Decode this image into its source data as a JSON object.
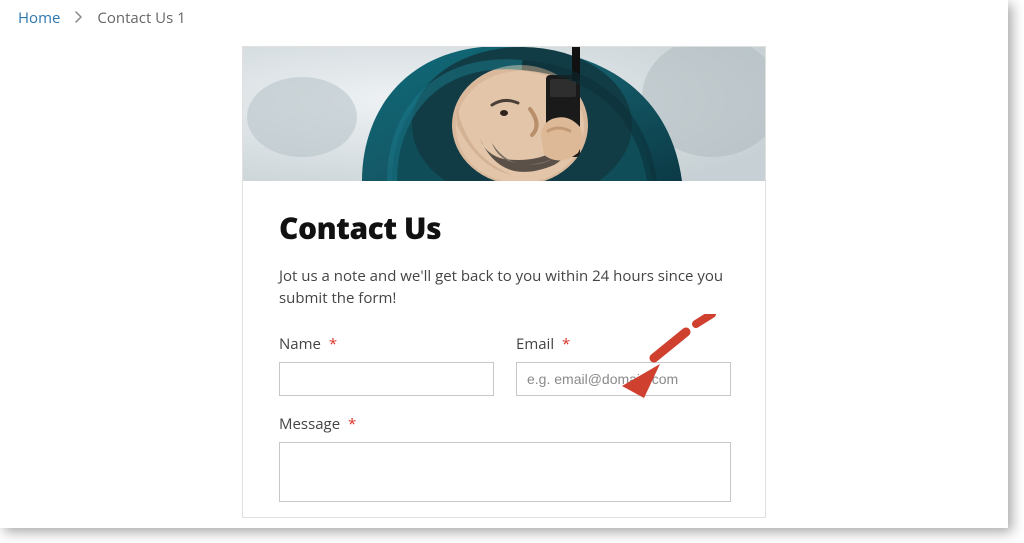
{
  "breadcrumb": {
    "home": "Home",
    "current": "Contact Us 1"
  },
  "card": {
    "title": "Contact Us",
    "subtitle": "Jot us a note and we'll get back to you within 24 hours since you submit the form!"
  },
  "form": {
    "required_marker": "*",
    "name": {
      "label": "Name",
      "placeholder": ""
    },
    "email": {
      "label": "Email",
      "placeholder": "e.g. email@domain.com"
    },
    "message": {
      "label": "Message",
      "placeholder": ""
    }
  },
  "colors": {
    "link": "#2c77ad",
    "required": "#d93025",
    "annotation": "#d0402f"
  }
}
